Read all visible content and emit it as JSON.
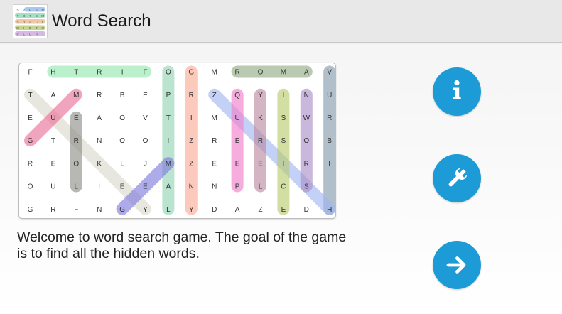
{
  "app": {
    "title": "Word Search",
    "icon": "word-search-grid-icon"
  },
  "intro": {
    "text": "Welcome to word search game. The goal of the game is to find all the hidden words."
  },
  "buttons": {
    "info": {
      "icon": "info-icon"
    },
    "settings": {
      "icon": "wrench-icon"
    },
    "play": {
      "icon": "arrow-right-icon"
    }
  },
  "colors": {
    "accent": "#1d9bd6",
    "action_bar": "#e8e8e8"
  },
  "app_icon_grid": [
    "SZPAN",
    "TOTEM",
    "SRACE",
    "WIDTH",
    "PLURT"
  ],
  "board": {
    "columns": 14,
    "rows": 7,
    "grid": [
      [
        "F",
        "H",
        "T",
        "R",
        "I",
        "F",
        "O",
        "G",
        "M",
        "R",
        "O",
        "M",
        "A",
        "V"
      ],
      [
        "T",
        "A",
        "M",
        "R",
        "B",
        "E",
        "P",
        "R",
        "Z",
        "Q",
        "Y",
        "I",
        "N",
        "U"
      ],
      [
        "E",
        "U",
        "E",
        "A",
        "O",
        "V",
        "T",
        "I",
        "M",
        "U",
        "K",
        "S",
        "W",
        "R"
      ],
      [
        "G",
        "T",
        "R",
        "N",
        "O",
        "O",
        "I",
        "Z",
        "R",
        "E",
        "R",
        "S",
        "O",
        "B"
      ],
      [
        "R",
        "E",
        "O",
        "K",
        "L",
        "J",
        "M",
        "Z",
        "E",
        "E",
        "E",
        "I",
        "R",
        "I"
      ],
      [
        "O",
        "U",
        "L",
        "I",
        "E",
        "E",
        "A",
        "N",
        "N",
        "P",
        "L",
        "C",
        "S"
      ],
      [
        "G",
        "R",
        "F",
        "N",
        "G",
        "Y",
        "L",
        "Y",
        "D",
        "A",
        "Z",
        "E",
        "D",
        "H"
      ]
    ],
    "highlights": [
      {
        "from": [
          0,
          1
        ],
        "to": [
          0,
          5
        ],
        "color": "#8fe6ad"
      },
      {
        "from": [
          0,
          6
        ],
        "to": [
          6,
          6
        ],
        "color": "#8fd3b3"
      },
      {
        "from": [
          0,
          7
        ],
        "to": [
          6,
          7
        ],
        "color": "#f8aa94"
      },
      {
        "from": [
          0,
          9
        ],
        "to": [
          0,
          12
        ],
        "color": "#8faa7f"
      },
      {
        "from": [
          0,
          13
        ],
        "to": [
          6,
          13
        ],
        "color": "#8097a8"
      },
      {
        "from": [
          1,
          0
        ],
        "to": [
          6,
          5
        ],
        "color": "#d9d8cd"
      },
      {
        "from": [
          1,
          2
        ],
        "to": [
          3,
          0
        ],
        "color": "#e86c95"
      },
      {
        "from": [
          1,
          8
        ],
        "to": [
          6,
          13
        ],
        "color": "#9fb4f2"
      },
      {
        "from": [
          1,
          9
        ],
        "to": [
          5,
          9
        ],
        "color": "#f07bc9"
      },
      {
        "from": [
          1,
          10
        ],
        "to": [
          5,
          10
        ],
        "color": "#b9869e"
      },
      {
        "from": [
          1,
          11
        ],
        "to": [
          6,
          11
        ],
        "color": "#b8c96a"
      },
      {
        "from": [
          1,
          12
        ],
        "to": [
          5,
          12
        ],
        "color": "#a98ac6"
      },
      {
        "from": [
          2,
          2
        ],
        "to": [
          5,
          2
        ],
        "color": "#8a8a85"
      },
      {
        "from": [
          4,
          6
        ],
        "to": [
          6,
          4
        ],
        "color": "#7a78dc"
      }
    ]
  }
}
